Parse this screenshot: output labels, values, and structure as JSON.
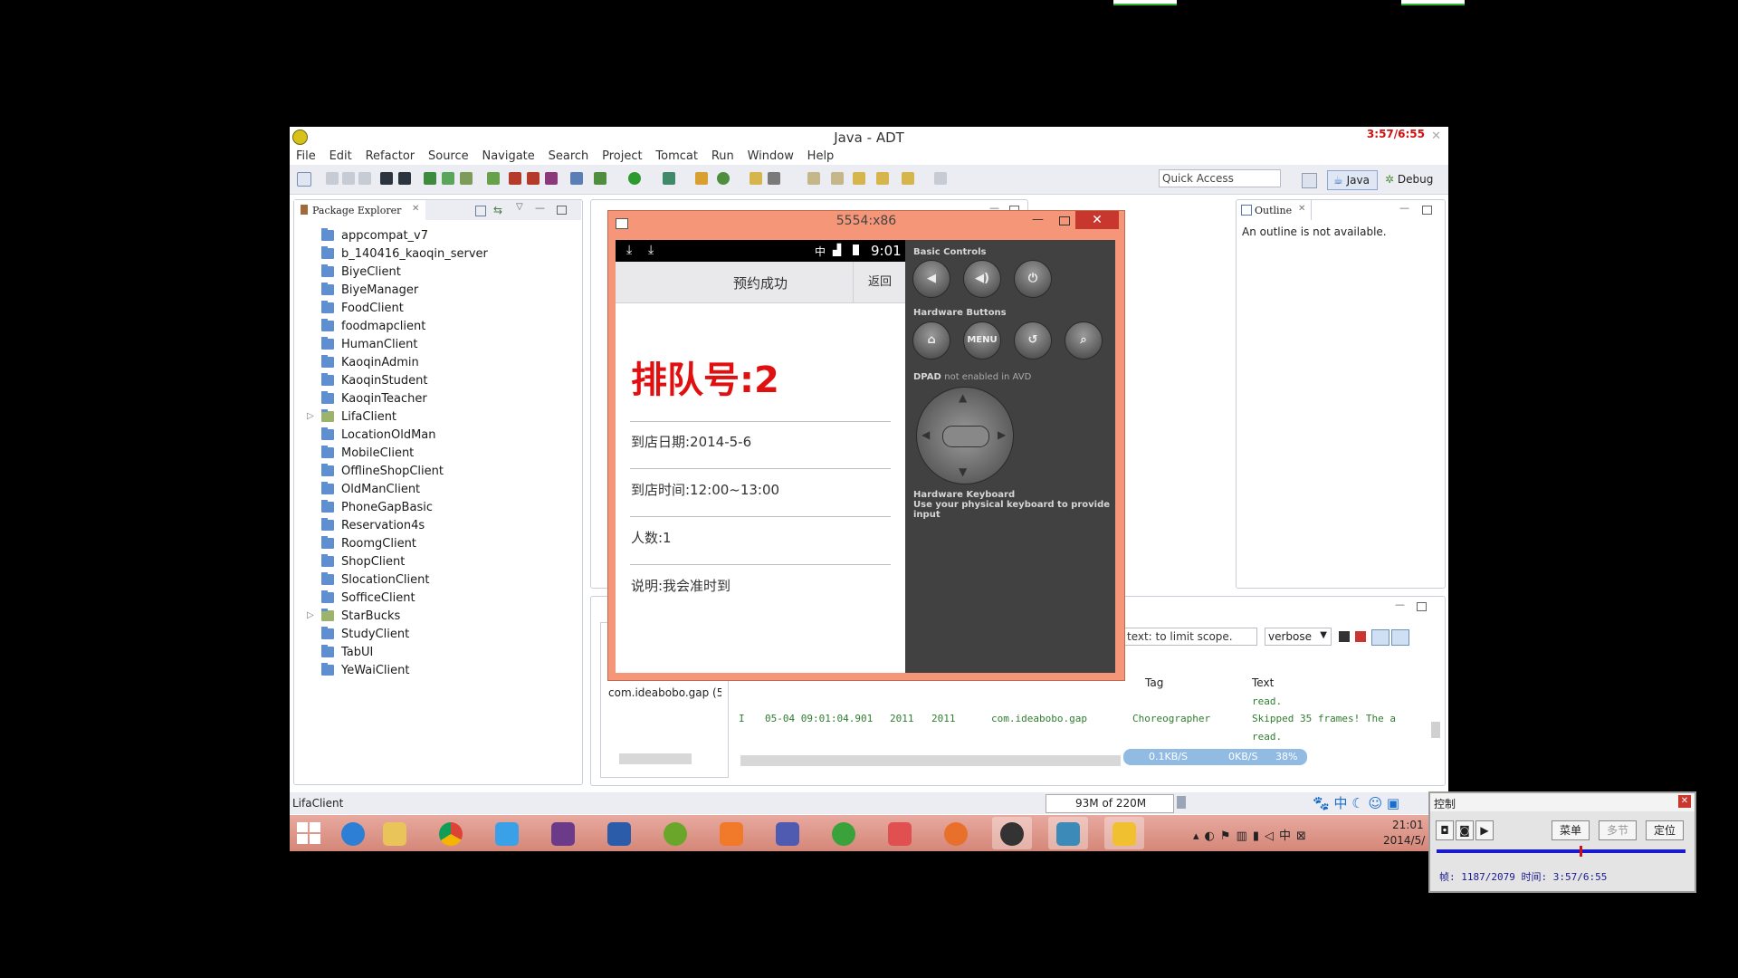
{
  "window": {
    "title": "Java - ADT",
    "overlay_clock": "3:57/6:55"
  },
  "menu": [
    "File",
    "Edit",
    "Refactor",
    "Source",
    "Navigate",
    "Search",
    "Project",
    "Tomcat",
    "Run",
    "Window",
    "Help"
  ],
  "toolbar": {
    "quick_access": "Quick Access",
    "java": "Java",
    "debug": "Debug"
  },
  "package_explorer": {
    "tab": "Package Explorer",
    "items": [
      {
        "label": "appcompat_v7",
        "type": "folder"
      },
      {
        "label": "b_140416_kaoqin_server",
        "type": "folder"
      },
      {
        "label": "BiyeClient",
        "type": "folder"
      },
      {
        "label": "BiyeManager",
        "type": "folder"
      },
      {
        "label": "FoodClient",
        "type": "folder"
      },
      {
        "label": "foodmapclient",
        "type": "folder"
      },
      {
        "label": "HumanClient",
        "type": "folder"
      },
      {
        "label": "KaoqinAdmin",
        "type": "folder"
      },
      {
        "label": "KaoqinStudent",
        "type": "folder"
      },
      {
        "label": "KaoqinTeacher",
        "type": "folder"
      },
      {
        "label": "LifaClient",
        "type": "project"
      },
      {
        "label": "LocationOldMan",
        "type": "folder"
      },
      {
        "label": "MobileClient",
        "type": "folder"
      },
      {
        "label": "OfflineShopClient",
        "type": "folder"
      },
      {
        "label": "OldManClient",
        "type": "folder"
      },
      {
        "label": "PhoneGapBasic",
        "type": "folder"
      },
      {
        "label": "Reservation4s",
        "type": "folder"
      },
      {
        "label": "RoomgClient",
        "type": "folder"
      },
      {
        "label": "ShopClient",
        "type": "folder"
      },
      {
        "label": "SlocationClient",
        "type": "folder"
      },
      {
        "label": "SofficeClient",
        "type": "folder"
      },
      {
        "label": "StarBucks",
        "type": "project"
      },
      {
        "label": "StudyClient",
        "type": "folder"
      },
      {
        "label": "TabUI",
        "type": "folder"
      },
      {
        "label": "YeWaiClient",
        "type": "folder"
      }
    ]
  },
  "outline": {
    "tab": "Outline",
    "message": "An outline is not available."
  },
  "emulator": {
    "title": "5554:x86",
    "status_time": "9:01",
    "status_ime": "中",
    "action_title": "预约成功",
    "back_button": "返回",
    "queue": "排队号:2",
    "rows": [
      "到店日期:2014-5-6",
      "到店时间:12:00~13:00",
      "人数:1",
      "说明:我会准时到"
    ],
    "controls": {
      "basic": "Basic Controls",
      "hardware": "Hardware Buttons",
      "menu": "MENU",
      "dpad": "DPAD",
      "dpad_note": "not enabled in AVD",
      "keyboard": "Hardware Keyboard",
      "keyboard_note": "Use your physical keyboard to provide input"
    }
  },
  "logcat": {
    "filter_placeholder": "text: to limit scope.",
    "level": "verbose",
    "device": "com.ideabobo.gap (5",
    "headers": {
      "tag": "Tag",
      "text": "Text"
    },
    "rows": [
      {
        "level": "",
        "time": "",
        "pid": "",
        "tid": "",
        "app": "",
        "tag": "",
        "text": "read."
      },
      {
        "level": "I",
        "time": "05-04 09:01:04.901",
        "pid": "2011",
        "tid": "2011",
        "app": "com.ideabobo.gap",
        "tag": "Choreographer",
        "text": "Skipped 35 frames!  The a"
      },
      {
        "level": "",
        "time": "",
        "pid": "",
        "tid": "",
        "app": "",
        "tag": "",
        "text": "read."
      }
    ],
    "net_overlay": {
      "up": "0.1KB/S",
      "down": "0KB/S",
      "pct": "38%"
    }
  },
  "statusbar": {
    "selection": "LifaClient",
    "heap": "93M of 220M"
  },
  "taskbar": {
    "time": "21:01",
    "date": "2014/5/",
    "ime": "中"
  },
  "control_window": {
    "title": "控制",
    "buttons": [
      "菜单",
      "多节",
      "定位"
    ],
    "info": "帧: 1187/2079 时间: 3:57/6:55",
    "progress": 0.575
  }
}
